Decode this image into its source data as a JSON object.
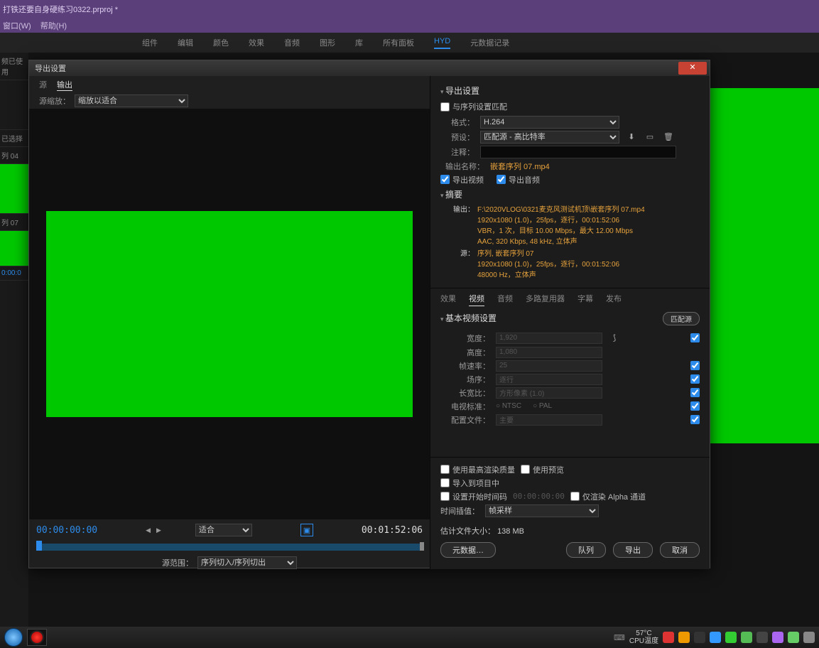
{
  "window": {
    "title": "打铁还要自身硬练习0322.prproj *"
  },
  "menubar": {
    "window": "窗口(W)",
    "help": "帮助(H)"
  },
  "workspaces": [
    "组件",
    "编辑",
    "颜色",
    "效果",
    "音频",
    "图形",
    "库",
    "所有面板",
    "HYD",
    "元数据记录"
  ],
  "workspace_active": "HYD",
  "left_strip": {
    "used": "频已使用",
    "selected": "已选择",
    "seq04": "列 04",
    "seq07": "列 07",
    "tc": "0:00:0"
  },
  "dialog": {
    "title": "导出设置",
    "tabs": {
      "source": "源",
      "output": "输出"
    },
    "source_scale_label": "源缩放：",
    "source_scale_value": "缩放以适合",
    "tc_in": "00:00:00:00",
    "tc_out": "00:01:52:06",
    "fit_label": "适合",
    "range_label": "源范围：",
    "range_value": "序列切入/序列切出",
    "export_settings": "导出设置",
    "match_seq": "与序列设置匹配",
    "format_label": "格式：",
    "format_value": "H.264",
    "preset_label": "预设：",
    "preset_value": "匹配源 - 高比特率",
    "comment_label": "注释：",
    "outname_label": "输出名称：",
    "outname_value": "嵌套序列 07.mp4",
    "export_video": "导出视频",
    "export_audio": "导出音频",
    "summary_head": "摘要",
    "summary_output_label": "输出：",
    "summary_output_line1": "F:\\2020VLOG\\0321麦克风测试机顶\\嵌套序列 07.mp4",
    "summary_output_line2": "1920x1080  (1.0)，25fps，逐行，00:01:52:06",
    "summary_output_line3": "VBR，1 次，目标 10.00 Mbps，最大 12.00 Mbps",
    "summary_output_line4": "AAC, 320 Kbps, 48  kHz, 立体声",
    "summary_source_label": "源：",
    "summary_source_line1": "序列, 嵌套序列 07",
    "summary_source_line2": "1920x1080  (1.0)，25fps，逐行，00:01:52:06",
    "summary_source_line3": "48000 Hz，立体声",
    "subtabs": [
      "效果",
      "视频",
      "音频",
      "多路复用器",
      "字幕",
      "发布"
    ],
    "subtab_active": "视频",
    "vset_head": "基本视频设置",
    "match_source_btn": "匹配源",
    "width_label": "宽度：",
    "width_value": "1,920",
    "height_label": "高度：",
    "height_value": "1,080",
    "fps_label": "帧速率：",
    "fps_value": "25",
    "field_label": "场序：",
    "field_value": "逐行",
    "par_label": "长宽比：",
    "par_value": "方形像素 (1.0)",
    "tvstd_label": "电视标准：",
    "tvstd_ntsc": "NTSC",
    "tvstd_pal": "PAL",
    "profile_label": "配置文件：",
    "profile_value": "主要",
    "use_max_quality": "使用最高渲染质量",
    "use_preview": "使用预览",
    "import_project": "导入到项目中",
    "set_start_tc": "设置开始时间码",
    "set_start_tc_val": "00:00:00:00",
    "render_alpha_only": "仅渲染 Alpha 通道",
    "interp_label": "时间插值：",
    "interp_value": "帧采样",
    "estimate_label": "估计文件大小：",
    "estimate_value": "138 MB",
    "btn_metadata": "元数据…",
    "btn_queue": "队列",
    "btn_export": "导出",
    "btn_cancel": "取消"
  },
  "taskbar": {
    "temp_value": "57°C",
    "temp_label": "CPU温度"
  }
}
